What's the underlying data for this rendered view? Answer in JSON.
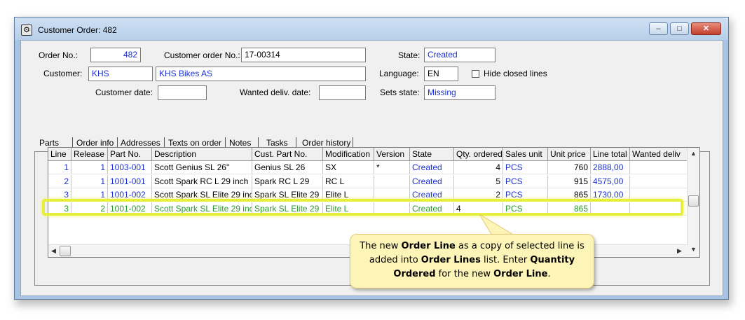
{
  "window": {
    "title": "Customer Order: 482",
    "btn_min": "–",
    "btn_max": "□",
    "btn_close": "✕"
  },
  "form": {
    "order_no_label": "Order No.:",
    "order_no": "482",
    "cust_order_no_label": "Customer order No.:",
    "cust_order_no": "17-00314",
    "state_label": "State:",
    "state": "Created",
    "customer_label": "Customer:",
    "customer_code": "KHS",
    "customer_name": "KHS Bikes AS",
    "language_label": "Language:",
    "language": "EN",
    "hide_closed_label": "Hide closed lines",
    "customer_date_label": "Customer date:",
    "customer_date": "",
    "wanted_deliv_label": "Wanted deliv. date:",
    "wanted_deliv": "",
    "sets_state_label": "Sets state:",
    "sets_state": "Missing"
  },
  "tabs": [
    "Parts",
    "Order info",
    "Addresses",
    "Texts on order",
    "Notes",
    "Tasks",
    "Order history"
  ],
  "grid": {
    "columns": [
      "Line",
      "Release",
      "Part No.",
      "Description",
      "Cust. Part No.",
      "Modification",
      "Version",
      "State",
      "Qty. ordered",
      "Sales unit",
      "Unit price",
      "Line total",
      "Wanted deliv"
    ],
    "rows": [
      [
        "1",
        "1",
        "1003-001",
        "Scott Genius SL 26\"",
        "Genius SL 26",
        "SX",
        "*",
        "Created",
        "4",
        "PCS",
        "760",
        "2888,00",
        ""
      ],
      [
        "2",
        "1",
        "1001-001",
        "Scott Spark RC L 29 inch",
        "Spark RC L 29",
        "RC L",
        "",
        "Created",
        "5",
        "PCS",
        "915",
        "4575,00",
        ""
      ],
      [
        "3",
        "1",
        "1001-002",
        "Scott Spark SL Elite 29 inc",
        "Spark SL Elite 29",
        "Elite L",
        "",
        "Created",
        "2",
        "PCS",
        "865",
        "1730,00",
        ""
      ],
      [
        "3",
        "2",
        "1001-002",
        "Scott Spark SL Elite 29 inc",
        "Spark SL Elite 29",
        "Elite L",
        "",
        "Created",
        "4",
        "PCS",
        "865",
        "",
        ""
      ]
    ]
  },
  "callout": {
    "t1": "The new ",
    "b1": "Order Line",
    "t2": " as a copy of selected line is added into ",
    "b2": "Order Lines",
    "t3": " list.  Enter ",
    "b3": "Quantity Ordered",
    "t4": " for the new ",
    "b4": "Order Line",
    "t5": "."
  },
  "colors": {
    "link_blue": "#1a2fd0",
    "new_row_green": "#2a9a2a",
    "highlight": "#e5ef3c",
    "callout_bg": "#fdf5b8"
  }
}
